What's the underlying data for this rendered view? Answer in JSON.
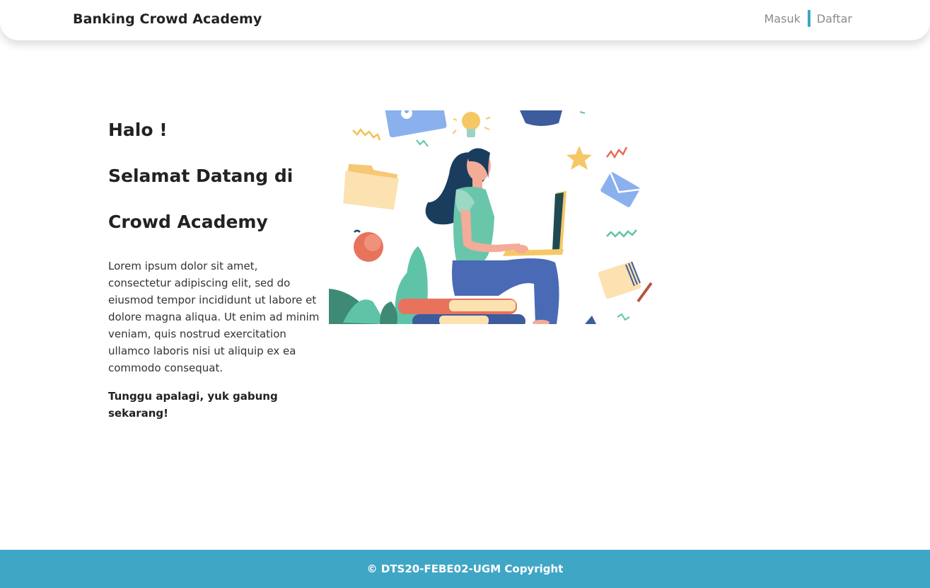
{
  "navbar": {
    "brand": "Banking Crowd Academy",
    "links": [
      {
        "label": "Masuk"
      },
      {
        "label": "Daftar"
      }
    ],
    "separator_color": "#3fa5c5"
  },
  "hero": {
    "lines": [
      "Halo !",
      "Selamat Datang di",
      "Crowd Academy"
    ],
    "paragraph": "Lorem ipsum dolor sit amet, consectetur adipiscing elit, sed do eiusmod tempor incididunt ut labore et dolore magna aliqua. Ut enim ad minim veniam, quis nostrud exercitation ullamco laboris nisi ut aliquip ex ea commodo consequat.",
    "cta": "Tunggu apalagi, yuk gabung sekarang!"
  },
  "illustration": {
    "icon": "woman-studying-on-laptop-illustration"
  },
  "footer": {
    "text": "© DTS20-FEBE02-UGM Copyright",
    "color": "#40a6c6"
  }
}
